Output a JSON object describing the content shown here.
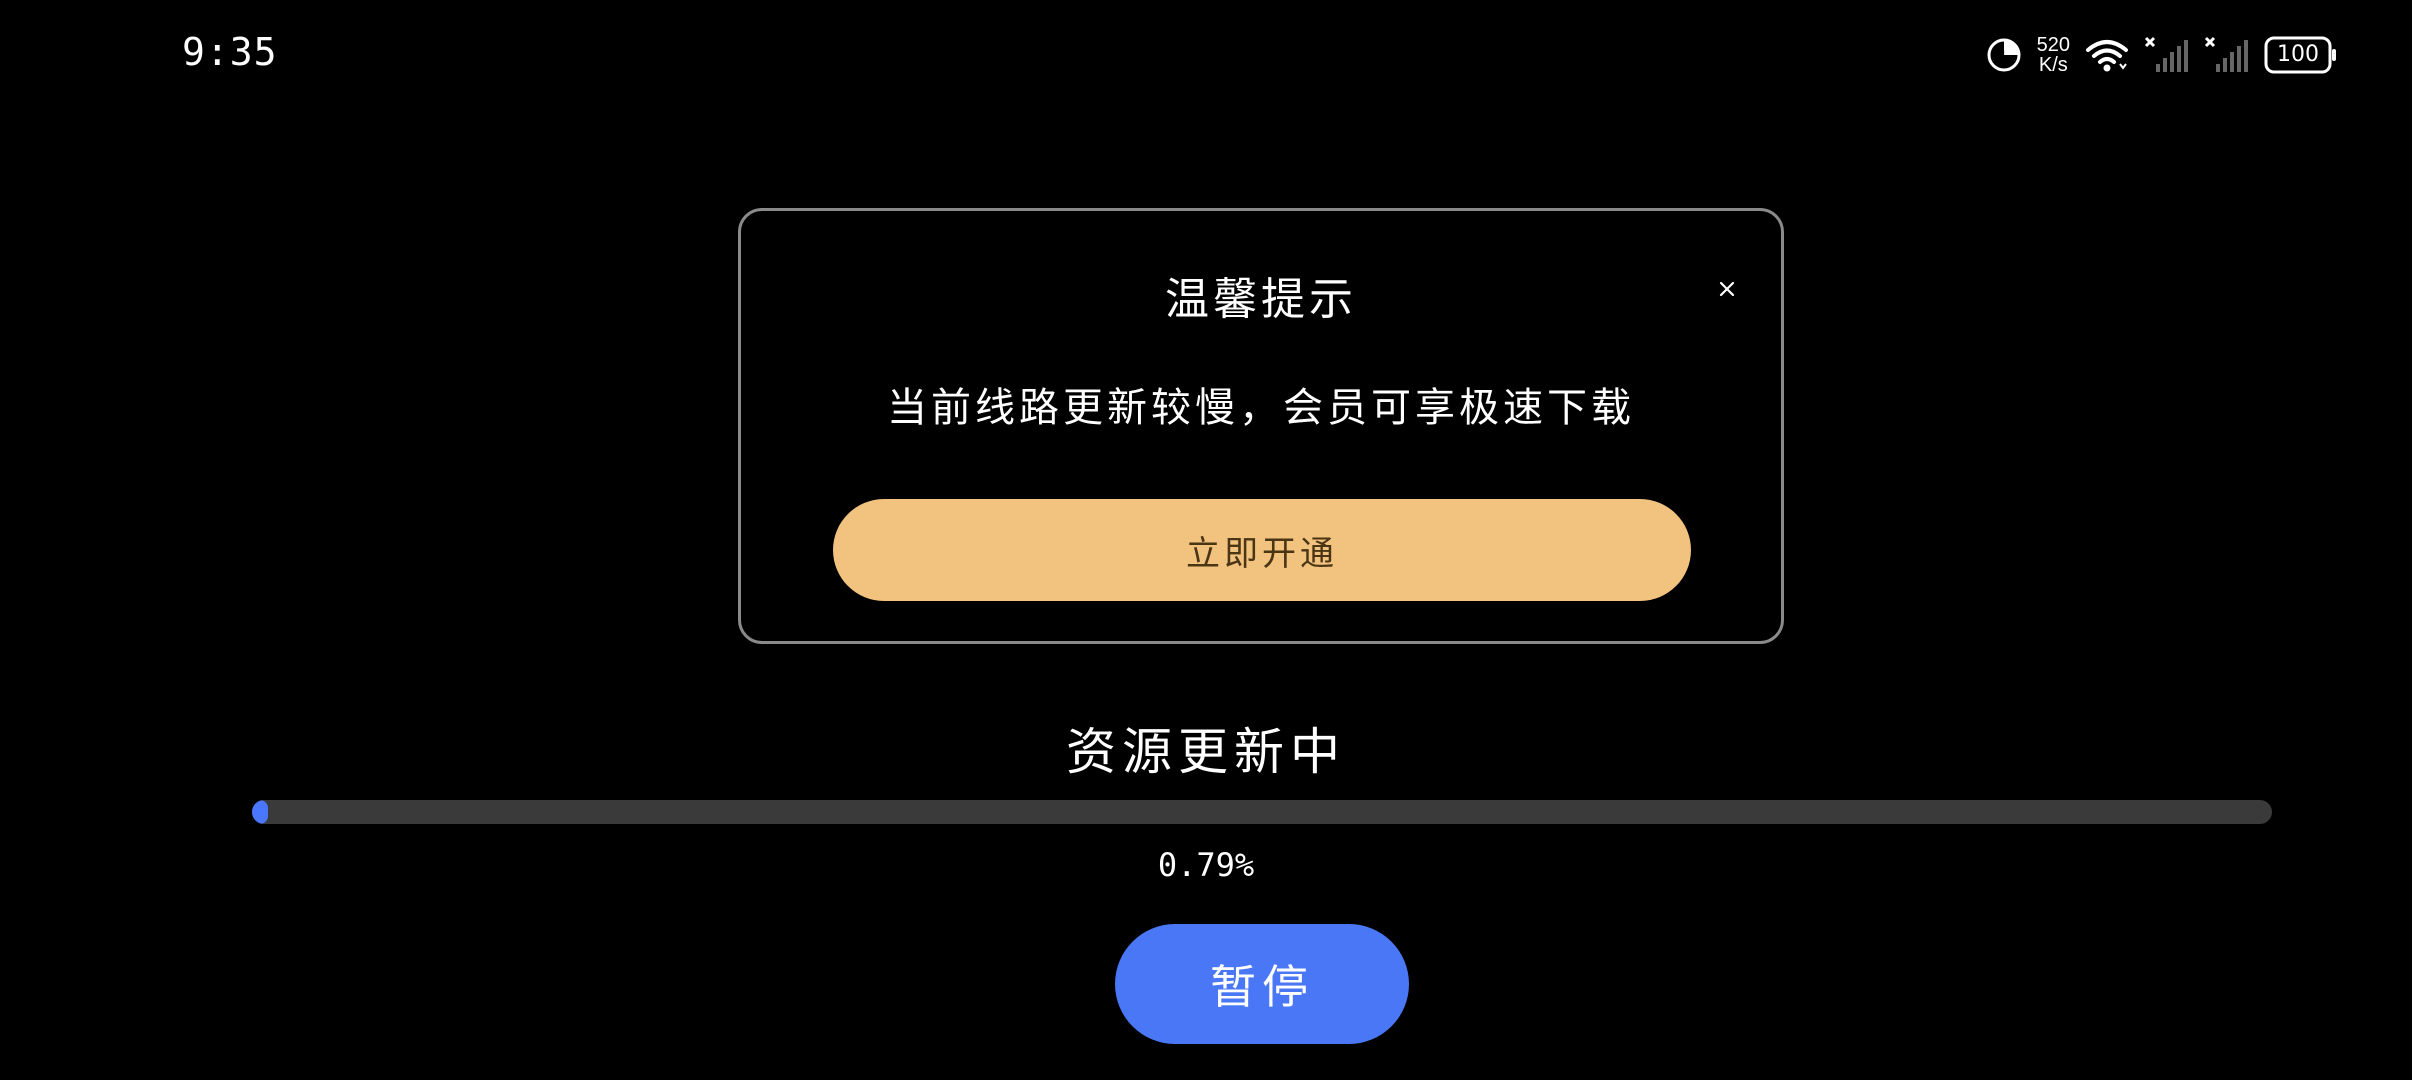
{
  "status_bar": {
    "time": "9:35",
    "net_speed_value": "520",
    "net_speed_unit": "K/s",
    "battery": "100",
    "icons": [
      "data-saver-icon",
      "wifi-icon",
      "signal-sim1-icon",
      "signal-sim2-icon",
      "battery-icon"
    ]
  },
  "dialog": {
    "title": "温馨提示",
    "message": "当前线路更新较慢，会员可享极速下载",
    "cta_label": "立即开通",
    "close_icon": "close-icon"
  },
  "progress": {
    "title": "资源更新中",
    "percent_text": "0.79%",
    "value": 0.0079
  },
  "pause_label": "暂停",
  "colors": {
    "background": "#000000",
    "cta": "#f2c27f",
    "pause": "#4a77f5",
    "track": "#3a3a3a"
  }
}
